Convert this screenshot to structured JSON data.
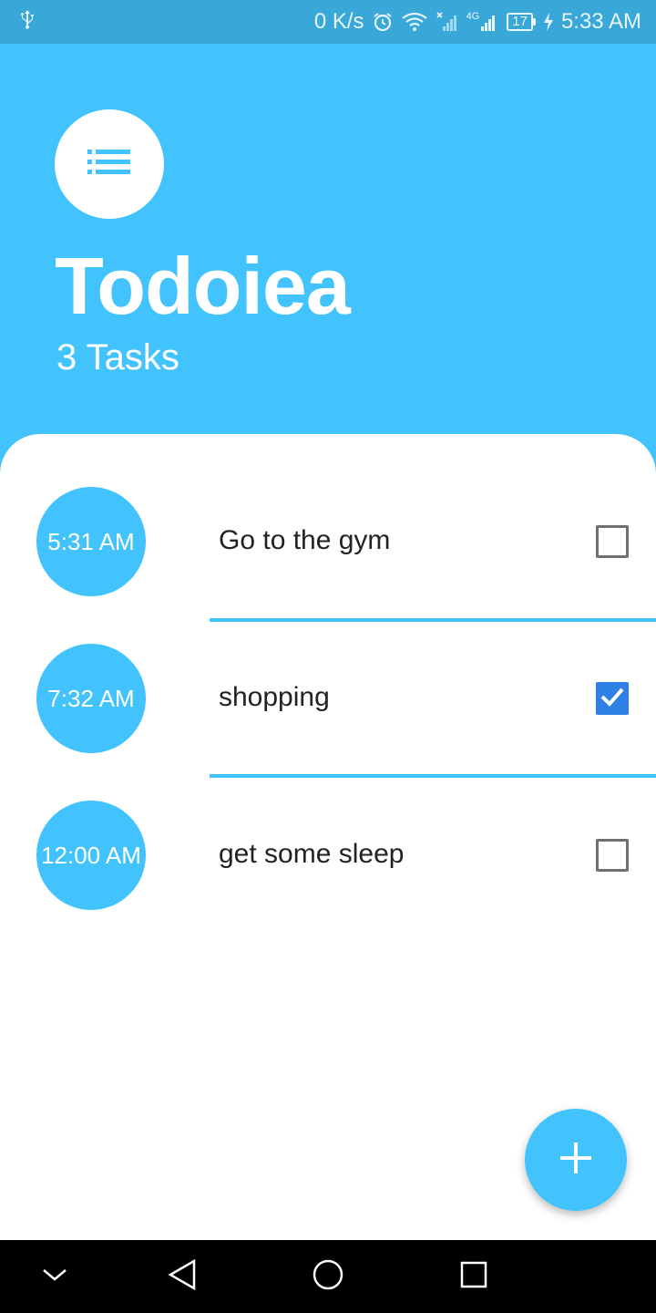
{
  "status_bar": {
    "net_speed": "0 K/s",
    "network": "4G",
    "battery": "17",
    "time": "5:33 AM"
  },
  "header": {
    "title": "Todoiea",
    "subtitle": "3 Tasks"
  },
  "tasks": [
    {
      "time": "5:31 AM",
      "title": "Go to the gym",
      "done": false
    },
    {
      "time": "7:32 AM",
      "title": "shopping",
      "done": true
    },
    {
      "time": "12:00 AM",
      "title": "get some sleep",
      "done": false
    }
  ],
  "colors": {
    "accent": "#42c3fe",
    "status_bar": "#3aa7d9",
    "checkbox_checked": "#2f80e4",
    "text": "#222222"
  },
  "icons": {
    "status_left": "usb-icon",
    "menu": "list-icon",
    "fab": "plus-icon",
    "nav": [
      "chevron-down-icon",
      "back-triangle-icon",
      "home-circle-icon",
      "recents-square-icon"
    ]
  }
}
